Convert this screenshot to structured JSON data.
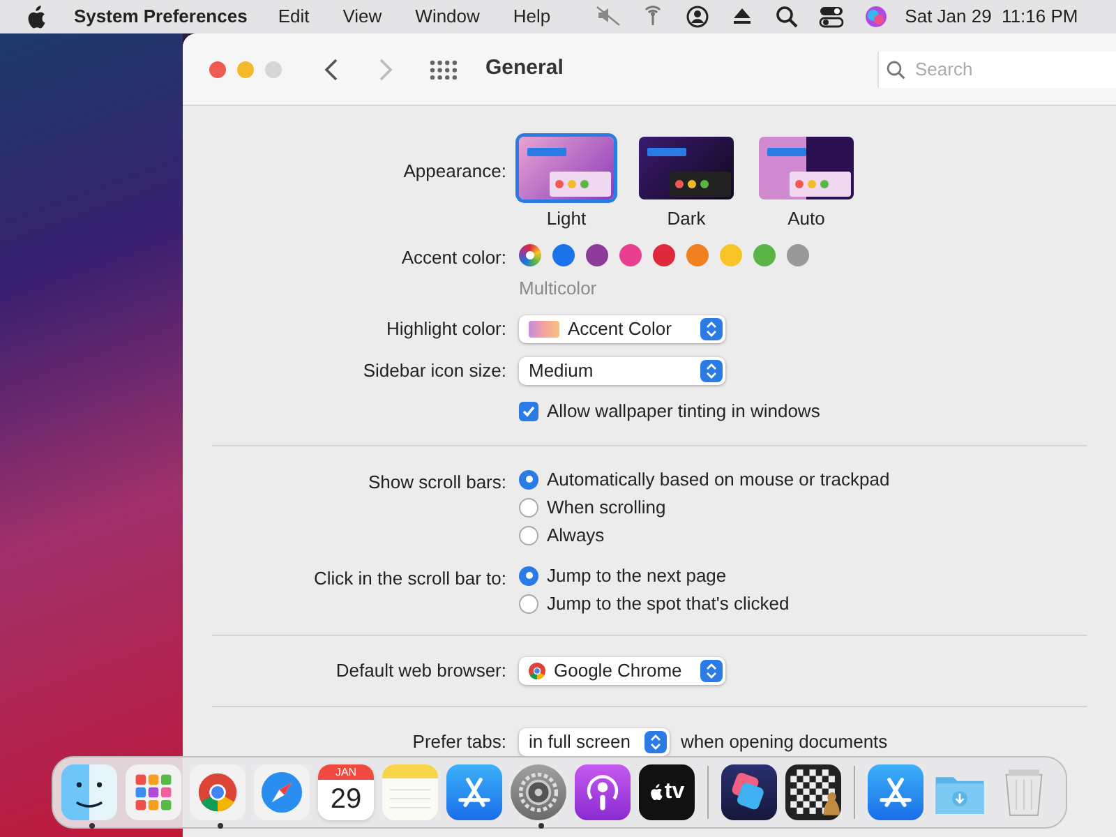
{
  "menubar": {
    "app": "System Preferences",
    "menus": [
      "Edit",
      "View",
      "Window",
      "Help"
    ],
    "clock": "Sat Jan 29  11:16 PM"
  },
  "window": {
    "title": "General",
    "search": {
      "placeholder": "Search"
    }
  },
  "appearance": {
    "label": "Appearance:",
    "options": [
      {
        "label": "Light",
        "kind": "light",
        "selected": true
      },
      {
        "label": "Dark",
        "kind": "dark",
        "selected": false
      },
      {
        "label": "Auto",
        "kind": "auto",
        "selected": false
      }
    ]
  },
  "accent": {
    "label": "Accent color:",
    "caption": "Multicolor",
    "colors": [
      {
        "kind": "multicolor",
        "selected": true
      },
      {
        "kind": "solid",
        "color": "#1a73e8",
        "selected": false
      },
      {
        "kind": "solid",
        "color": "#8e3a9a",
        "selected": false
      },
      {
        "kind": "solid",
        "color": "#e8408f",
        "selected": false
      },
      {
        "kind": "solid",
        "color": "#e0283c",
        "selected": false
      },
      {
        "kind": "solid",
        "color": "#f08020",
        "selected": false
      },
      {
        "kind": "solid",
        "color": "#f7c325",
        "selected": false
      },
      {
        "kind": "solid",
        "color": "#5ab546",
        "selected": false
      },
      {
        "kind": "solid",
        "color": "#999999",
        "selected": false
      }
    ]
  },
  "highlight": {
    "label": "Highlight color:",
    "value": "Accent Color"
  },
  "sidebar_icon_size": {
    "label": "Sidebar icon size:",
    "value": "Medium"
  },
  "wallpaper_tinting": {
    "label": "Allow wallpaper tinting in windows",
    "checked": true
  },
  "scroll_bars": {
    "label": "Show scroll bars:",
    "options": [
      {
        "label": "Automatically based on mouse or trackpad",
        "selected": true
      },
      {
        "label": "When scrolling",
        "selected": false
      },
      {
        "label": "Always",
        "selected": false
      }
    ]
  },
  "click_scroll_bar": {
    "label": "Click in the scroll bar to:",
    "options": [
      {
        "label": "Jump to the next page",
        "selected": true
      },
      {
        "label": "Jump to the spot that's clicked",
        "selected": false
      }
    ]
  },
  "browser": {
    "label": "Default web browser:",
    "value": "Google Chrome"
  },
  "prefer_tabs": {
    "label": "Prefer tabs:",
    "value": "in full screen",
    "suffix": "when opening documents"
  },
  "dock": {
    "items": [
      {
        "kind": "finder",
        "running": true
      },
      {
        "kind": "launchpad",
        "running": false
      },
      {
        "kind": "chrome",
        "running": true
      },
      {
        "kind": "safari",
        "running": false
      },
      {
        "kind": "calendar",
        "month": "JAN",
        "day": "29",
        "running": false
      },
      {
        "kind": "notes",
        "running": false
      },
      {
        "kind": "appstore",
        "running": false
      },
      {
        "kind": "settings",
        "running": true
      },
      {
        "kind": "podcasts",
        "running": false
      },
      {
        "kind": "tv",
        "text": "tv",
        "running": false
      },
      {
        "kind": "separator"
      },
      {
        "kind": "shortcuts",
        "running": false
      },
      {
        "kind": "chess",
        "running": false
      },
      {
        "kind": "separator"
      },
      {
        "kind": "appstore",
        "running": false
      },
      {
        "kind": "downloads"
      },
      {
        "kind": "trash"
      }
    ]
  }
}
